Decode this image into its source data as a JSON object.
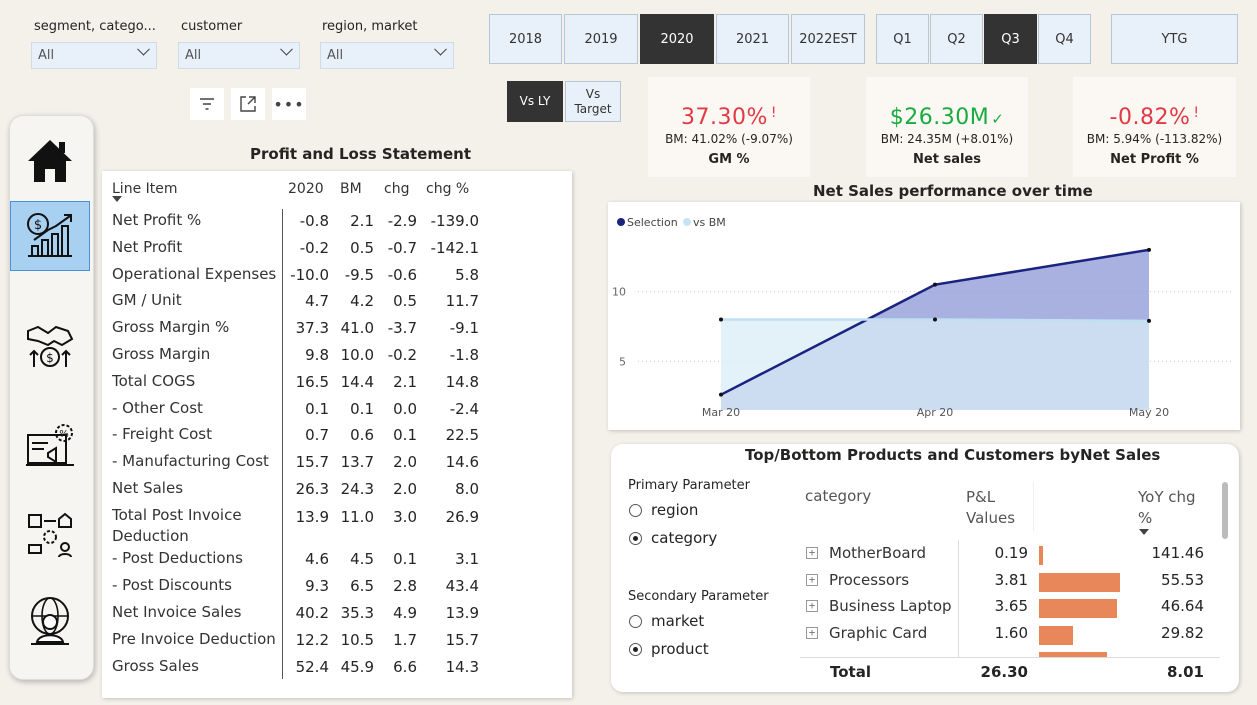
{
  "filters": {
    "segment": {
      "title": "segment, catego...",
      "value": "All"
    },
    "customer": {
      "title": "customer",
      "value": "All"
    },
    "region": {
      "title": "region, market",
      "value": "All"
    }
  },
  "years": [
    "2018",
    "2019",
    "2020",
    "2021",
    "2022EST"
  ],
  "selected_year": "2020",
  "quarters": [
    "Q1",
    "Q2",
    "Q3",
    "Q4"
  ],
  "selected_quarter": "Q3",
  "ytg_label": "YTG",
  "compare": {
    "vs_ly": "Vs LY",
    "vs_target": "Vs\nTarget"
  },
  "kpis": {
    "gm": {
      "value": "37.30%",
      "mark": "!",
      "bm": "BM: 41.02% (-9.07%)",
      "label": "GM %",
      "color": "#e23a45"
    },
    "net_sales": {
      "value": "$26.30M",
      "mark": "✓",
      "bm": "BM: 24.35M (+8.01%)",
      "label": "Net sales",
      "color": "#1aab40"
    },
    "net_profit": {
      "value": "-0.82%",
      "mark": "!",
      "bm": "BM: 5.94% (-113.82%)",
      "label": "Net Profit %",
      "color": "#e23a45"
    }
  },
  "pl": {
    "title": "Profit and Loss Statement",
    "headers": {
      "line_item": "Line Item",
      "year": "2020",
      "bm": "BM",
      "chg": "chg",
      "chg_pct": "chg %"
    },
    "rows": [
      {
        "item": "Net Profit %",
        "y": "-0.8",
        "bm": "2.1",
        "chg": "-2.9",
        "pct": "-139.0"
      },
      {
        "item": "Net Profit",
        "y": "-0.2",
        "bm": "0.5",
        "chg": "-0.7",
        "pct": "-142.1"
      },
      {
        "item": "Operational Expenses",
        "y": "-10.0",
        "bm": "-9.5",
        "chg": "-0.6",
        "pct": "5.8"
      },
      {
        "item": "GM / Unit",
        "y": "4.7",
        "bm": "4.2",
        "chg": "0.5",
        "pct": "11.7"
      },
      {
        "item": "Gross Margin %",
        "y": "37.3",
        "bm": "41.0",
        "chg": "-3.7",
        "pct": "-9.1"
      },
      {
        "item": "Gross Margin",
        "y": "9.8",
        "bm": "10.0",
        "chg": "-0.2",
        "pct": "-1.8"
      },
      {
        "item": "Total COGS",
        "y": "16.5",
        "bm": "14.4",
        "chg": "2.1",
        "pct": "14.8"
      },
      {
        "item": "- Other Cost",
        "y": "0.1",
        "bm": "0.1",
        "chg": "0.0",
        "pct": "-2.4"
      },
      {
        "item": "- Freight Cost",
        "y": "0.7",
        "bm": "0.6",
        "chg": "0.1",
        "pct": "22.5"
      },
      {
        "item": "- Manufacturing Cost",
        "y": "15.7",
        "bm": "13.7",
        "chg": "2.0",
        "pct": "14.6"
      },
      {
        "item": "Net Sales",
        "y": "26.3",
        "bm": "24.3",
        "chg": "2.0",
        "pct": "8.0"
      },
      {
        "item": "Total Post Invoice",
        "item2": "Deduction",
        "y": "13.9",
        "bm": "11.0",
        "chg": "3.0",
        "pct": "26.9"
      },
      {
        "item": "- Post Deductions",
        "y": "4.6",
        "bm": "4.5",
        "chg": "0.1",
        "pct": "3.1"
      },
      {
        "item": "- Post Discounts",
        "y": "9.3",
        "bm": "6.5",
        "chg": "2.8",
        "pct": "43.4"
      },
      {
        "item": "Net Invoice Sales",
        "y": "40.2",
        "bm": "35.3",
        "chg": "4.9",
        "pct": "13.9"
      },
      {
        "item": "Pre Invoice Deduction",
        "y": "12.2",
        "bm": "10.5",
        "chg": "1.7",
        "pct": "15.7"
      },
      {
        "item": "Gross Sales",
        "y": "52.4",
        "bm": "45.9",
        "chg": "6.6",
        "pct": "14.3"
      }
    ]
  },
  "chart_data": {
    "type": "area",
    "title": "Net Sales performance over time",
    "categories": [
      "Mar 20",
      "Apr 20",
      "May 20"
    ],
    "yticks": [
      5,
      10
    ],
    "ylim": [
      1.5,
      15
    ],
    "series": [
      {
        "name": "Selection",
        "values": [
          2.6,
          10.5,
          13.0
        ],
        "color": "#1a237e"
      },
      {
        "name": "vs BM",
        "values": [
          8.0,
          8.0,
          7.9
        ],
        "color": "#c6e3f5"
      }
    ],
    "legend": "top-left",
    "grid": true
  },
  "topbottom": {
    "title": "Top/Bottom Products and Customers byNet Sales",
    "primary_label": "Primary Parameter",
    "primary_options": [
      "region",
      "category"
    ],
    "primary_selected": "category",
    "secondary_label": "Secondary Parameter",
    "secondary_options": [
      "market",
      "product"
    ],
    "secondary_selected": "product",
    "headers": {
      "category": "category",
      "pl": "P&L\nValues",
      "yoy": "YoY chg\n%"
    },
    "rows": [
      {
        "name": "MotherBoard",
        "value": "0.19",
        "yoy": "141.46",
        "bar": 0.19
      },
      {
        "name": "Processors",
        "value": "3.81",
        "yoy": "55.53",
        "bar": 3.81
      },
      {
        "name": "Business Laptop",
        "value": "3.65",
        "yoy": "46.64",
        "bar": 3.65
      },
      {
        "name": "Graphic Card",
        "value": "1.60",
        "yoy": "29.82",
        "bar": 1.6
      }
    ],
    "bar_max": 3.81,
    "total": {
      "label": "Total",
      "value": "26.30",
      "yoy": "8.01"
    }
  }
}
